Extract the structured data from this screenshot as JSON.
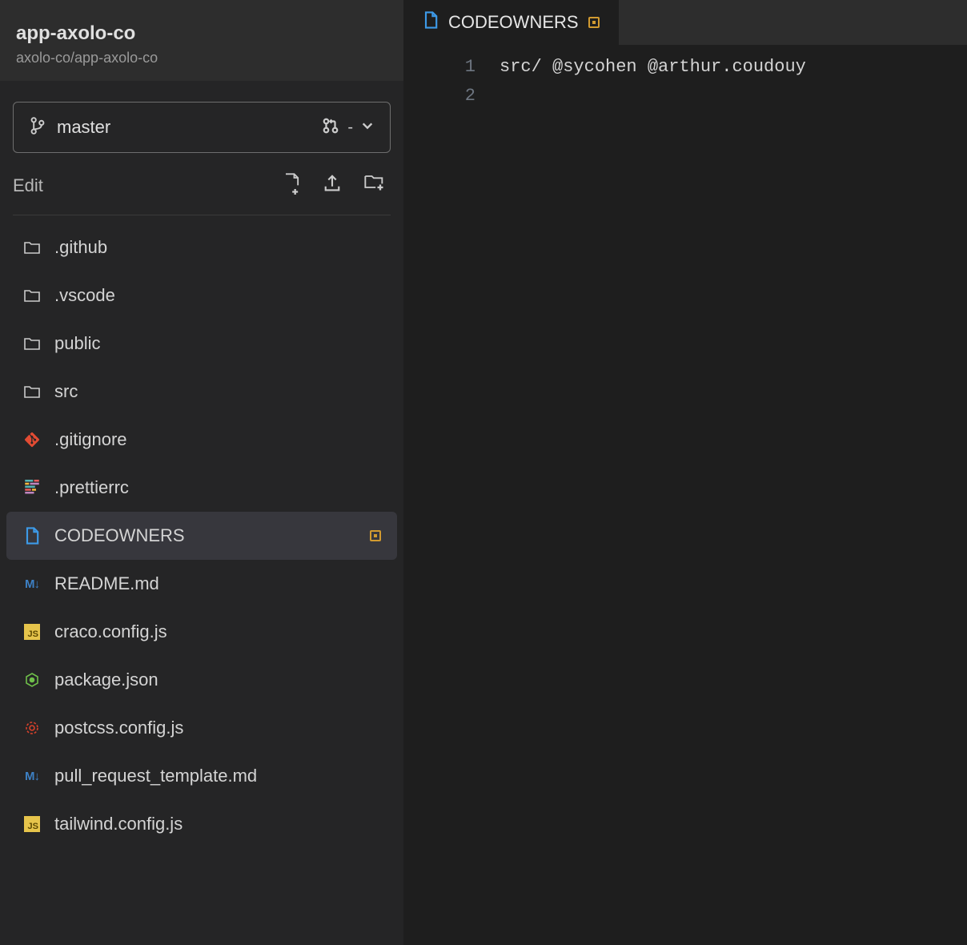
{
  "header": {
    "repo_title": "app-axolo-co",
    "repo_path": "axolo-co/app-axolo-co"
  },
  "branch": {
    "name": "master",
    "pr_indicator": "-"
  },
  "toolbar": {
    "edit_label": "Edit"
  },
  "files": [
    {
      "name": ".github",
      "icon": "folder",
      "active": false,
      "modified": false
    },
    {
      "name": ".vscode",
      "icon": "folder",
      "active": false,
      "modified": false
    },
    {
      "name": "public",
      "icon": "folder",
      "active": false,
      "modified": false
    },
    {
      "name": "src",
      "icon": "folder",
      "active": false,
      "modified": false
    },
    {
      "name": ".gitignore",
      "icon": "git",
      "active": false,
      "modified": false
    },
    {
      "name": ".prettierrc",
      "icon": "prettier",
      "active": false,
      "modified": false
    },
    {
      "name": "CODEOWNERS",
      "icon": "file-blue",
      "active": true,
      "modified": true
    },
    {
      "name": "README.md",
      "icon": "md",
      "active": false,
      "modified": false
    },
    {
      "name": "craco.config.js",
      "icon": "js",
      "active": false,
      "modified": false
    },
    {
      "name": "package.json",
      "icon": "npm",
      "active": false,
      "modified": false
    },
    {
      "name": "postcss.config.js",
      "icon": "postcss",
      "active": false,
      "modified": false
    },
    {
      "name": "pull_request_template.md",
      "icon": "md",
      "active": false,
      "modified": false
    },
    {
      "name": "tailwind.config.js",
      "icon": "js",
      "active": false,
      "modified": false
    }
  ],
  "tab": {
    "filename": "CODEOWNERS",
    "modified": true
  },
  "editor_lines": [
    "src/ @sycohen @arthur.coudouy",
    ""
  ]
}
